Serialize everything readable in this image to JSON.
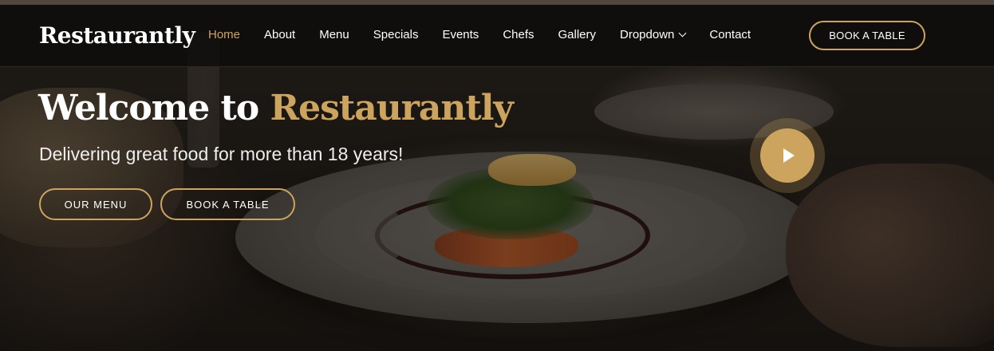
{
  "brand": {
    "name": "Restaurantly"
  },
  "nav": {
    "items": [
      {
        "label": "Home",
        "active": true
      },
      {
        "label": "About"
      },
      {
        "label": "Menu"
      },
      {
        "label": "Specials"
      },
      {
        "label": "Events"
      },
      {
        "label": "Chefs"
      },
      {
        "label": "Gallery"
      },
      {
        "label": "Dropdown",
        "icon": "chevron-down-icon"
      },
      {
        "label": "Contact"
      }
    ],
    "book_button": "BOOK A TABLE"
  },
  "hero": {
    "title_prefix": "Welcome to",
    "title_accent": "Restaurantly",
    "subtitle": "Delivering great food for more than 18 years!",
    "btn_menu": "OUR MENU",
    "btn_book": "BOOK A TABLE",
    "play_icon": "play-icon"
  },
  "colors": {
    "accent": "#cda45e",
    "header_bg": "#0c0b0a",
    "text": "#ffffff"
  }
}
